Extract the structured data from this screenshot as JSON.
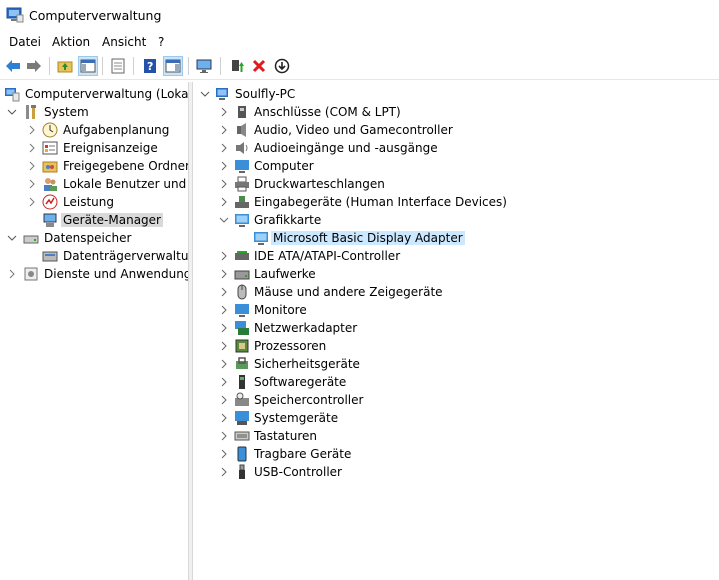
{
  "window": {
    "title": "Computerverwaltung"
  },
  "menu": {
    "items": [
      "Datei",
      "Aktion",
      "Ansicht",
      "?"
    ]
  },
  "toolbar": {
    "buttons": [
      "back-icon",
      "forward-icon",
      "up-folder-icon",
      "show-hide-tree-icon",
      "properties-icon",
      "help-icon",
      "action-pane-icon",
      "monitor-icon",
      "update-driver-icon",
      "uninstall-icon",
      "disable-icon"
    ]
  },
  "left_tree": {
    "root": "Computerverwaltung (Lokal)",
    "system": "System",
    "aufgabenplanung": "Aufgabenplanung",
    "ereignisanzeige": "Ereignisanzeige",
    "freigegebene_ordner": "Freigegebene Ordner",
    "lokale_benutzer": "Lokale Benutzer und Gru",
    "leistung": "Leistung",
    "geraete_manager": "Geräte-Manager",
    "datenspeicher": "Datenspeicher",
    "datentraeger": "Datenträgerverwaltung",
    "dienste": "Dienste und Anwendungen"
  },
  "device_tree": {
    "root": "Soulfly-PC",
    "categories": [
      "Anschlüsse (COM & LPT)",
      "Audio, Video und Gamecontroller",
      "Audioeingänge und -ausgänge",
      "Computer",
      "Druckwarteschlangen",
      "Eingabegeräte (Human Interface Devices)",
      "Grafikkarte",
      "IDE ATA/ATAPI-Controller",
      "Laufwerke",
      "Mäuse und andere Zeigegeräte",
      "Monitore",
      "Netzwerkadapter",
      "Prozessoren",
      "Sicherheitsgeräte",
      "Softwaregeräte",
      "Speichercontroller",
      "Systemgeräte",
      "Tastaturen",
      "Tragbare Geräte",
      "USB-Controller"
    ],
    "grafikkarte_child": "Microsoft Basic Display Adapter"
  }
}
